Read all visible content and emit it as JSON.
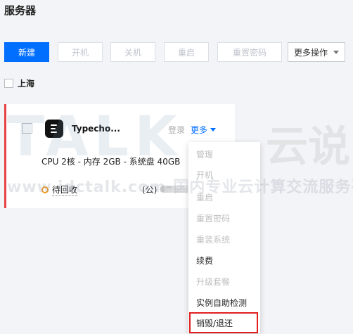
{
  "page": {
    "title": "服务器"
  },
  "toolbar": {
    "buttons": [
      {
        "label": "新建"
      },
      {
        "label": "开机"
      },
      {
        "label": "关机"
      },
      {
        "label": "重启"
      },
      {
        "label": "重置密码"
      }
    ],
    "more_label": "更多操作"
  },
  "region": {
    "label": "上海"
  },
  "instance": {
    "name": "Typecho...",
    "login_label": "登录",
    "more_label": "更多",
    "spec": "CPU 2核 - 内存 2GB - 系统盘 40GB",
    "status": "待回收",
    "ip_suffix": "(公)"
  },
  "menu": {
    "items": [
      {
        "label": "管理",
        "enabled": false
      },
      {
        "label": "开机",
        "enabled": false
      },
      {
        "label": "重启",
        "enabled": false
      },
      {
        "label": "重置密码",
        "enabled": false
      },
      {
        "label": "重装系统",
        "enabled": false
      },
      {
        "label": "续费",
        "enabled": true
      },
      {
        "label": "升级套餐",
        "enabled": false
      },
      {
        "label": "实例自助检测",
        "enabled": true
      },
      {
        "label": "销毁/退还",
        "enabled": true,
        "highlighted": true
      }
    ]
  },
  "watermark": {
    "brand": "TALK",
    "cn": "云说",
    "line": "www.idctalk.com-国内专业云计算交流服务平台"
  },
  "colors": {
    "primary": "#006eff",
    "status_orange": "#f29c1f",
    "card_accent": "#e54545",
    "highlight_border": "#e02020"
  }
}
